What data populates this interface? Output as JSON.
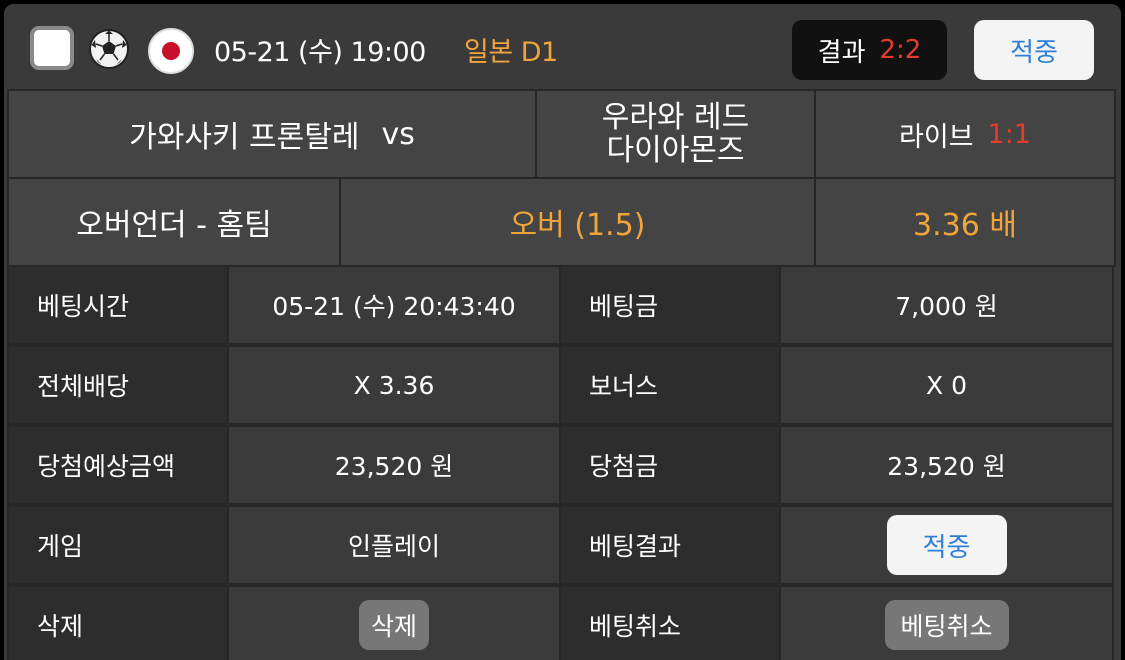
{
  "header": {
    "match_datetime": "05-21 (수) 19:00",
    "league": "일본 D1",
    "result_label": "결과",
    "result_score": "2:2",
    "hit_button": "적중"
  },
  "match": {
    "home_team": "가와사키 프론탈레",
    "vs": "vs",
    "away_team_line1": "우라와 레드",
    "away_team_line2": "다이아몬즈",
    "live_label": "라이브",
    "live_score": "1:1"
  },
  "bet": {
    "market": "오버언더 - 홈팀",
    "pick": "오버 (1.5)",
    "odds": "3.36 배"
  },
  "details": [
    {
      "label1": "베팅시간",
      "value1": "05-21 (수) 20:43:40",
      "label2": "베팅금",
      "value2": "7,000 원"
    },
    {
      "label1": "전체배당",
      "value1": "X 3.36",
      "label2": "보너스",
      "value2": "X 0"
    },
    {
      "label1": "당첨예상금액",
      "value1": "23,520 원",
      "label2": "당첨금",
      "value2": "23,520 원"
    }
  ],
  "game_row": {
    "label1": "게임",
    "value1": "인플레이",
    "label2": "베팅결과",
    "result_button": "적중"
  },
  "action_row": {
    "label1": "삭제",
    "delete_button": "삭제",
    "label2": "베팅취소",
    "cancel_button": "베팅취소"
  },
  "icons": {
    "sport": "soccer-ball-icon",
    "country": "japan-flag-icon"
  },
  "colors": {
    "accent_orange": "#f0a43a",
    "score_red": "#e63c2c",
    "hit_blue": "#2f7fd8"
  }
}
